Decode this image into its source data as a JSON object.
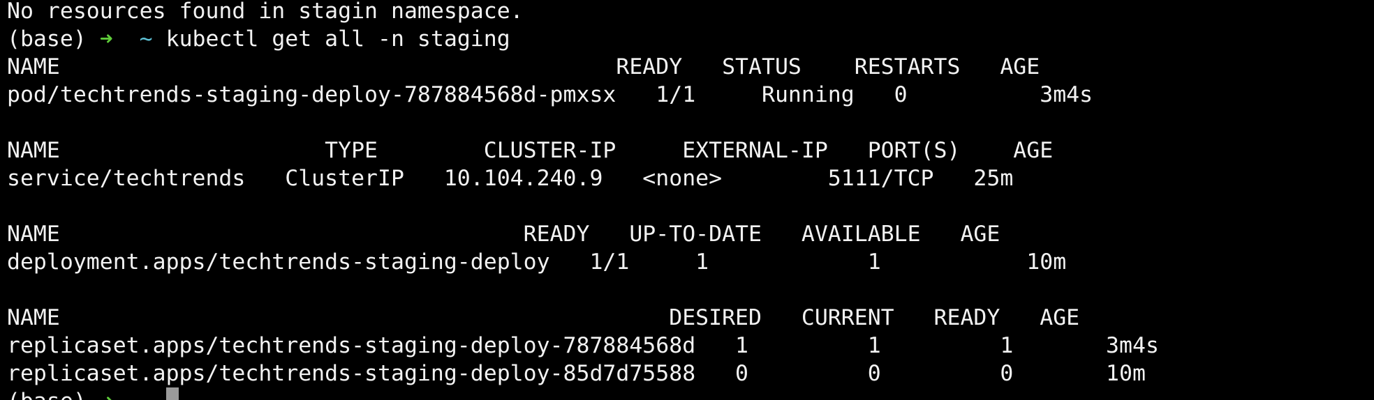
{
  "terminal": {
    "background": "#000000",
    "foreground": "#f2f2f2",
    "prompt_arrow_color": "#5fcc3a",
    "prompt_tilde_color": "#5ec2d6",
    "message": "No resources found in stagin namespace.",
    "prompt": {
      "env": "(base)",
      "arrow": "➜",
      "dir": "~"
    },
    "command": "kubectl get all -n staging",
    "pods": {
      "header": "NAME                                          READY   STATUS    RESTARTS   AGE",
      "rows": [
        "pod/techtrends-staging-deploy-787884568d-pmxsx   1/1     Running   0          3m4s"
      ]
    },
    "services": {
      "header": "NAME                    TYPE        CLUSTER-IP     EXTERNAL-IP   PORT(S)    AGE",
      "rows": [
        "service/techtrends   ClusterIP   10.104.240.9   <none>        5111/TCP   25m"
      ]
    },
    "deployments": {
      "header": "NAME                                   READY   UP-TO-DATE   AVAILABLE   AGE",
      "rows": [
        "deployment.apps/techtrends-staging-deploy   1/1     1            1           10m"
      ]
    },
    "replicasets": {
      "header": "NAME                                              DESIRED   CURRENT   READY   AGE",
      "rows": [
        "replicaset.apps/techtrends-staging-deploy-787884568d   1         1         1       3m4s",
        "replicaset.apps/techtrends-staging-deploy-85d7d75588   0         0         0       10m"
      ]
    }
  }
}
